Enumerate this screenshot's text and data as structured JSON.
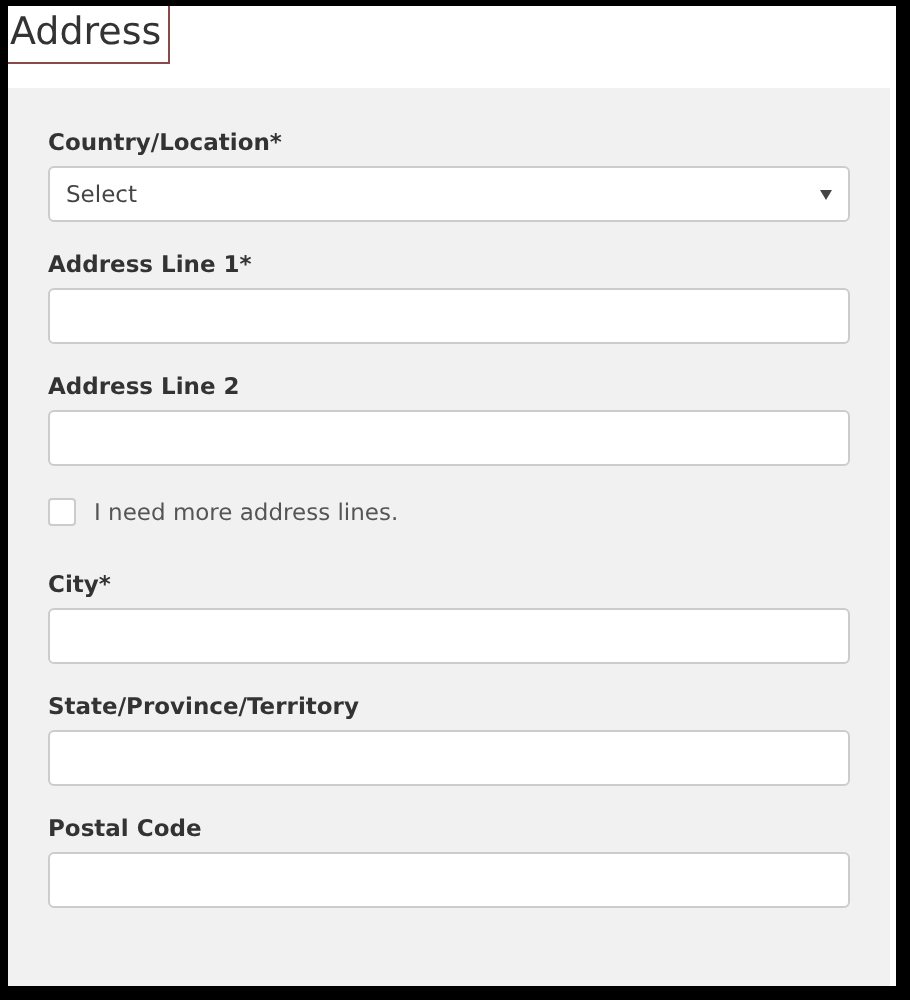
{
  "title": "Address",
  "fields": [
    {
      "kind": "select",
      "label": "Country/Location*",
      "value": "Select"
    },
    {
      "kind": "text",
      "label": "Address Line 1*"
    },
    {
      "kind": "text",
      "label": "Address Line 2"
    },
    {
      "kind": "checkbox",
      "label": "I need more address lines.",
      "checked": false
    },
    {
      "kind": "text",
      "label": "City*"
    },
    {
      "kind": "text",
      "label": "State/Province/Territory"
    },
    {
      "kind": "text",
      "label": "Postal Code"
    }
  ]
}
